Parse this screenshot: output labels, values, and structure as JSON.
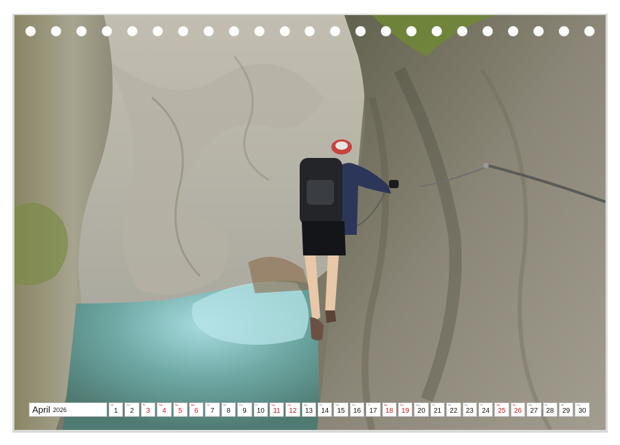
{
  "calendar": {
    "month": "April",
    "year": "2026",
    "days": [
      {
        "num": "1",
        "abbr": "Mi",
        "red": false
      },
      {
        "num": "2",
        "abbr": "Do",
        "red": false
      },
      {
        "num": "3",
        "abbr": "Fr",
        "red": true
      },
      {
        "num": "4",
        "abbr": "Sa",
        "red": true
      },
      {
        "num": "5",
        "abbr": "So",
        "red": true
      },
      {
        "num": "6",
        "abbr": "Mo",
        "red": true
      },
      {
        "num": "7",
        "abbr": "Di",
        "red": false
      },
      {
        "num": "8",
        "abbr": "Mi",
        "red": false
      },
      {
        "num": "9",
        "abbr": "Do",
        "red": false
      },
      {
        "num": "10",
        "abbr": "Fr",
        "red": false
      },
      {
        "num": "11",
        "abbr": "Sa",
        "red": true
      },
      {
        "num": "12",
        "abbr": "So",
        "red": true
      },
      {
        "num": "13",
        "abbr": "Mo",
        "red": false
      },
      {
        "num": "14",
        "abbr": "Di",
        "red": false
      },
      {
        "num": "15",
        "abbr": "Mi",
        "red": false
      },
      {
        "num": "16",
        "abbr": "Do",
        "red": false
      },
      {
        "num": "17",
        "abbr": "Fr",
        "red": false
      },
      {
        "num": "18",
        "abbr": "Sa",
        "red": true
      },
      {
        "num": "19",
        "abbr": "So",
        "red": true
      },
      {
        "num": "20",
        "abbr": "Mo",
        "red": false
      },
      {
        "num": "21",
        "abbr": "Di",
        "red": false
      },
      {
        "num": "22",
        "abbr": "Mi",
        "red": false
      },
      {
        "num": "23",
        "abbr": "Do",
        "red": false
      },
      {
        "num": "24",
        "abbr": "Fr",
        "red": false
      },
      {
        "num": "25",
        "abbr": "Sa",
        "red": true
      },
      {
        "num": "26",
        "abbr": "So",
        "red": true
      },
      {
        "num": "27",
        "abbr": "Mo",
        "red": false
      },
      {
        "num": "28",
        "abbr": "Di",
        "red": false
      },
      {
        "num": "29",
        "abbr": "Mi",
        "red": false
      },
      {
        "num": "30",
        "abbr": "Do",
        "red": false
      }
    ]
  },
  "binding": {
    "hole_count": 23
  },
  "colors": {
    "holiday": "#d3121a",
    "text": "#111111"
  }
}
